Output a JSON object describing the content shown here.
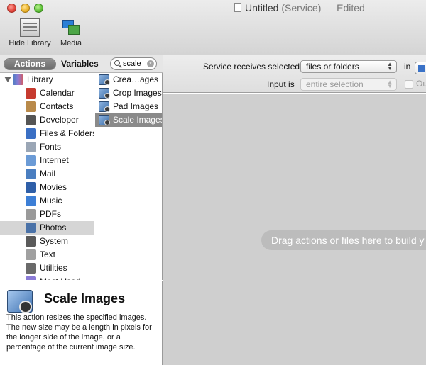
{
  "window": {
    "title": "Untitled",
    "subtitle": "(Service) — Edited"
  },
  "toolbar": {
    "hide_library_label": "Hide Library",
    "media_label": "Media"
  },
  "library_header": {
    "actions_tab": "Actions",
    "variables_tab": "Variables",
    "search_value": "scale"
  },
  "library": {
    "root_label": "Library",
    "items": [
      {
        "label": "Calendar",
        "icon": "calendar-icon",
        "color": "#c63a2f"
      },
      {
        "label": "Contacts",
        "icon": "contacts-icon",
        "color": "#b98a4a"
      },
      {
        "label": "Developer",
        "icon": "developer-icon",
        "color": "#555555"
      },
      {
        "label": "Files & Folders",
        "icon": "finder-icon",
        "color": "#3a6fc4"
      },
      {
        "label": "Fonts",
        "icon": "fonts-icon",
        "color": "#9aa6b5"
      },
      {
        "label": "Internet",
        "icon": "internet-icon",
        "color": "#6b9bd6"
      },
      {
        "label": "Mail",
        "icon": "mail-icon",
        "color": "#4a7ec0"
      },
      {
        "label": "Movies",
        "icon": "movies-icon",
        "color": "#2f5fa8"
      },
      {
        "label": "Music",
        "icon": "music-icon",
        "color": "#3d7fd6"
      },
      {
        "label": "PDFs",
        "icon": "pdf-icon",
        "color": "#9a9a9a"
      },
      {
        "label": "Photos",
        "icon": "photos-icon",
        "color": "#4a72a8",
        "selected": true
      },
      {
        "label": "System",
        "icon": "system-icon",
        "color": "#5a5a5a"
      },
      {
        "label": "Text",
        "icon": "text-icon",
        "color": "#a0a0a0"
      },
      {
        "label": "Utilities",
        "icon": "utilities-icon",
        "color": "#6a6a6a"
      },
      {
        "label": "Most Used",
        "icon": "most-used-icon",
        "color": "#8b7bd6"
      }
    ]
  },
  "actions_list": [
    {
      "label": "Crea…ages"
    },
    {
      "label": "Crop Images"
    },
    {
      "label": "Pad Images"
    },
    {
      "label": "Scale Images",
      "selected": true
    }
  ],
  "description": {
    "title": "Scale Images",
    "text": "This action resizes the specified images. The new size may be a length in pixels for the longer side of the image, or a percentage of the current image size."
  },
  "service_config": {
    "receives_label": "Service receives selected",
    "receives_value": "files or folders",
    "in_label": "in",
    "input_label": "Input is",
    "input_value": "entire selection",
    "output_label": "Ou"
  },
  "workflow": {
    "drag_hint": "Drag actions or files here to build y"
  }
}
